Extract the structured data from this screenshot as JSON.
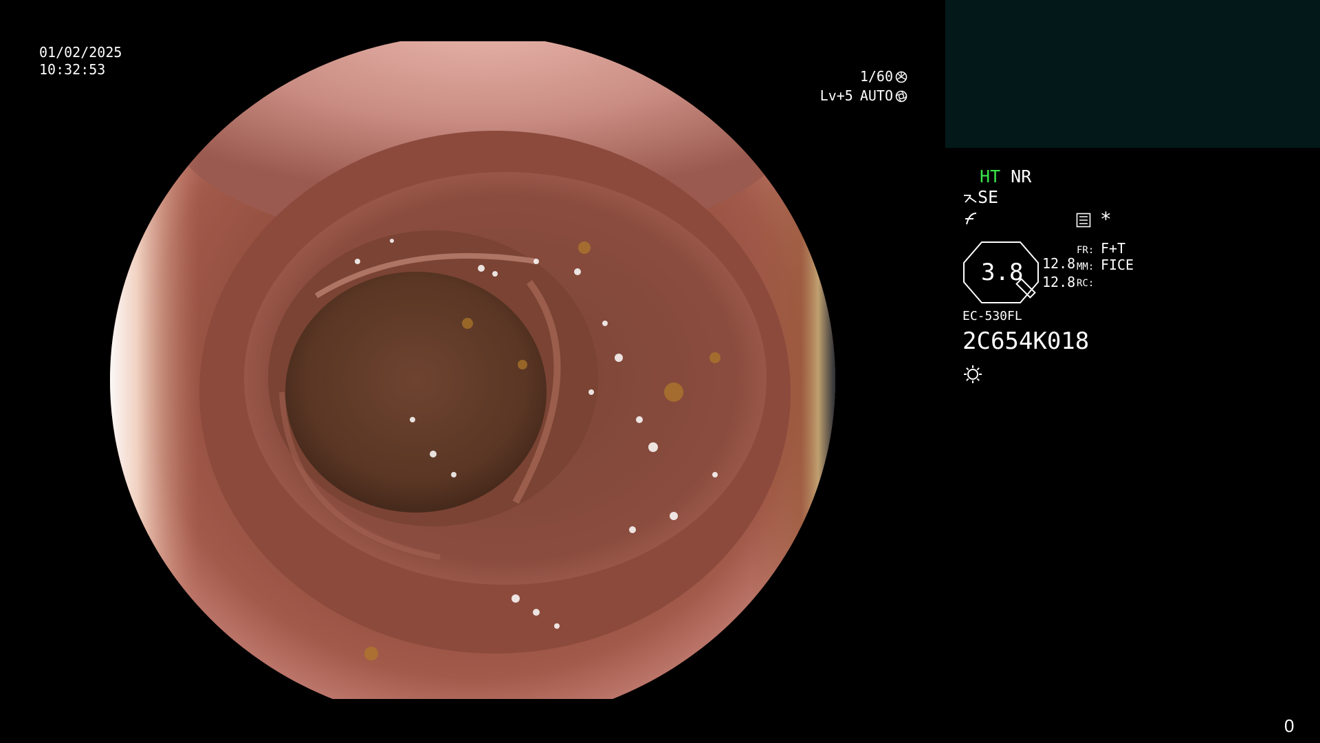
{
  "datetime": {
    "date": "01/02/2025",
    "time": "10:32:53"
  },
  "exposure": {
    "shutter": "1/60",
    "level": "Lv+5",
    "mode": "AUTO"
  },
  "settings": {
    "ht": "HT",
    "nr": "NR",
    "se": "SE",
    "asterisk": "*",
    "zoom": "3.8",
    "val1": "12.8",
    "val2": "12.8",
    "fr_label": "FR:",
    "fr_value": "F+T",
    "mm_label": "MM:",
    "mm_value": "FICE",
    "rc_label": "RC:"
  },
  "scope": {
    "model": "EC-530FL",
    "serial": "2C654K018"
  },
  "counter": "0",
  "colors": {
    "ht_green": "#39e64a",
    "panel": "#031819"
  }
}
